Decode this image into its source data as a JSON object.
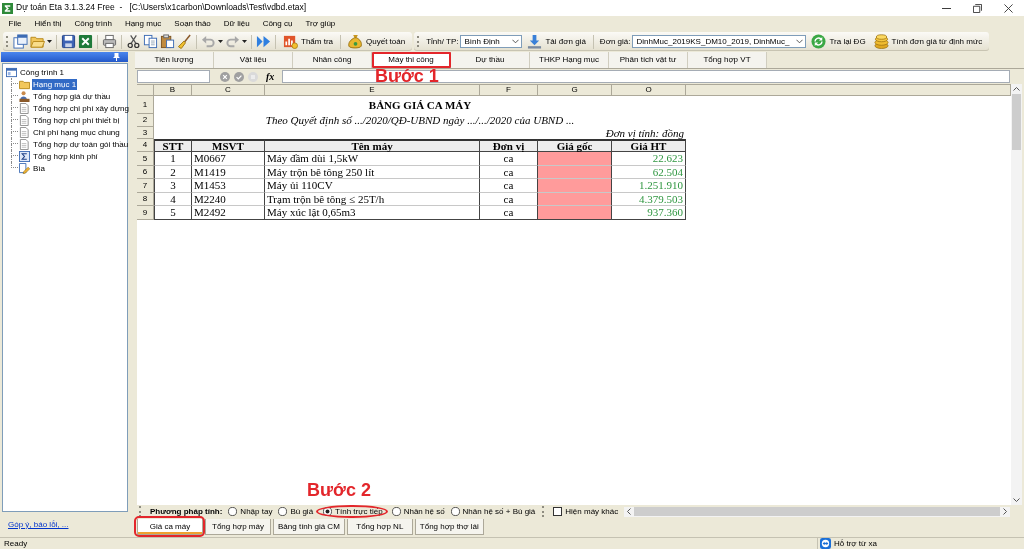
{
  "window": {
    "title": "Dự toán Eta 3.1.3.24 Free  -   [C:\\Users\\x1carbon\\Downloads\\Test\\vdbd.etax]"
  },
  "menu": [
    "File",
    "Hiển thị",
    "Công trình",
    "Hạng mục",
    "Soạn thảo",
    "Dữ liệu",
    "Công cụ",
    "Trợ giúp"
  ],
  "toolbar": {
    "buttons": [
      {
        "label": "Thẩm tra",
        "kind": "report"
      },
      {
        "label": "Quyết toán",
        "kind": "money"
      }
    ]
  },
  "price_toolbar": {
    "province_label": "Tỉnh/ TP:",
    "province": "Bình Định",
    "load_button": "Tải đơn giá",
    "price_label": "Đơn giá:",
    "price_set": "DinhMuc_2019KS_DM10_2019, DinhMuc_",
    "buttons": [
      {
        "label": "Tra lại ĐG",
        "kind": "refresh"
      },
      {
        "label": "Tính đơn giá từ định mức",
        "kind": "coins"
      }
    ]
  },
  "sidebar": {
    "tree": [
      {
        "label": "Công trình 1",
        "kind": "project",
        "selected": false,
        "children": [
          {
            "label": "Hạng mục 1",
            "kind": "folder",
            "selected": true
          },
          {
            "label": "Tổng hợp giá dự thầu",
            "kind": "team",
            "selected": false
          },
          {
            "label": "Tổng hợp chi phí xây dựng",
            "kind": "document",
            "selected": false
          },
          {
            "label": "Tổng hợp chi phí thiết bị",
            "kind": "document",
            "selected": false
          },
          {
            "label": "Chi phí hạng mục chung",
            "kind": "document",
            "selected": false
          },
          {
            "label": "Tổng hợp dự toán gói thầu",
            "kind": "document",
            "selected": false
          },
          {
            "label": "Tổng hợp kinh phí",
            "kind": "sum",
            "selected": false
          },
          {
            "label": "Bìa",
            "kind": "cover",
            "selected": false
          }
        ]
      }
    ],
    "feedback_link": "Góp ý, báo lỗi, ..."
  },
  "tabs": [
    {
      "label": "Tiên lượng",
      "selected": false,
      "highlighted": false
    },
    {
      "label": "Vật liệu",
      "selected": false,
      "highlighted": false
    },
    {
      "label": "Nhân công",
      "selected": false,
      "highlighted": false
    },
    {
      "label": "Máy thi công",
      "selected": true,
      "highlighted": true,
      "callout": "Bước 1"
    },
    {
      "label": "Dự thầu",
      "selected": false,
      "highlighted": false
    },
    {
      "label": "THKP Hạng mục",
      "selected": false,
      "highlighted": false
    },
    {
      "label": "Phân tích vật tư",
      "selected": false,
      "highlighted": false
    },
    {
      "label": "Tổng hợp VT",
      "selected": false,
      "highlighted": false
    }
  ],
  "formula_bar": {
    "function_label": "fx"
  },
  "sheet": {
    "columns": [
      "B",
      "C",
      "E",
      "F",
      "G",
      "O"
    ],
    "row_numbers": [
      "1",
      "2",
      "3",
      "4",
      "5",
      "6",
      "7",
      "8",
      "9"
    ],
    "title": "BẢNG GIÁ CA MÁY",
    "subtitle": "Theo Quyết định số .../2020/QĐ-UBND ngày .../.../2020 của UBND ...",
    "unit_note": "Đơn vị tính: đồng",
    "header": [
      "STT",
      "MSVT",
      "Tên máy",
      "Đơn vị",
      "Giá gốc",
      "Giá HT"
    ],
    "rows": [
      {
        "stt": "1",
        "code": "M0667",
        "name": "Máy đầm dùi 1,5kW",
        "unit": "ca",
        "current_price": "22.623"
      },
      {
        "stt": "2",
        "code": "M1419",
        "name": "Máy trộn bê tông 250 lít",
        "unit": "ca",
        "current_price": "62.504"
      },
      {
        "stt": "3",
        "code": "M1453",
        "name": "Máy ủi 110CV",
        "unit": "ca",
        "current_price": "1.251.910"
      },
      {
        "stt": "4",
        "code": "M2240",
        "name": "Trạm trộn bê tông ≤ 25T/h",
        "unit": "ca",
        "current_price": "4.379.503"
      },
      {
        "stt": "5",
        "code": "M2492",
        "name": "Máy xúc lật 0,65m3",
        "unit": "ca",
        "current_price": "937.360"
      }
    ]
  },
  "calc_method": {
    "label": "Phương pháp tính:",
    "options": [
      {
        "label": "Nhập tay",
        "selected": false,
        "highlighted": false
      },
      {
        "label": "Bù giá",
        "selected": false,
        "highlighted": false
      },
      {
        "label": "Tính trực tiếp",
        "selected": true,
        "highlighted": true,
        "callout": "Bước 2"
      },
      {
        "label": "Nhân hệ số",
        "selected": false,
        "highlighted": false
      },
      {
        "label": "Nhân hệ số + Bù giá",
        "selected": false,
        "highlighted": false
      }
    ],
    "show_other": {
      "label": "Hiện máy khác",
      "checked": false
    }
  },
  "sheet_tabs": [
    {
      "label": "Giá ca máy",
      "selected": true,
      "highlighted": true
    },
    {
      "label": "Tổng hợp máy",
      "selected": false,
      "highlighted": false
    },
    {
      "label": "Bảng tính giá CM",
      "selected": false,
      "highlighted": false
    },
    {
      "label": "Tổng hợp NL",
      "selected": false,
      "highlighted": false
    },
    {
      "label": "Tổng hợp thợ lái",
      "selected": false,
      "highlighted": false
    }
  ],
  "status_bar": {
    "status": "Ready",
    "remote_support": "Hỗ trợ từ xa"
  }
}
